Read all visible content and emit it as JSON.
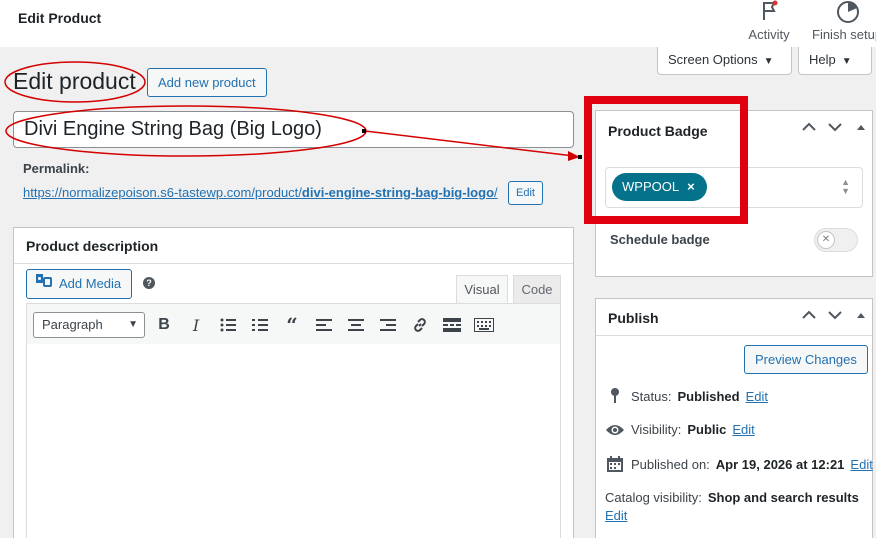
{
  "topbar": {
    "title": "Edit Product",
    "activity_label": "Activity",
    "finish_setup_label": "Finish setup"
  },
  "screen_tabs": {
    "screen_options": "Screen Options",
    "help": "Help"
  },
  "heading": {
    "title": "Edit product",
    "add_new_label": "Add new product"
  },
  "product": {
    "title": "Divi Engine String Bag (Big Logo)",
    "permalink_label": "Permalink:",
    "permalink_base": "https://normalizepoison.s6-tastewp.com/product/",
    "permalink_slug": "divi-engine-string-bag-big-logo",
    "permalink_tail": "/",
    "edit_label": "Edit"
  },
  "description": {
    "title": "Product description",
    "add_media_label": "Add Media",
    "help_glyph": "?",
    "tab_visual": "Visual",
    "tab_code": "Code",
    "format_select": "Paragraph"
  },
  "badge_box": {
    "title": "Product Badge",
    "selected_badge": "WPPOOL",
    "remove_glyph": "×",
    "schedule_label": "Schedule badge",
    "schedule_enabled": false,
    "highlight_color": "#e1000f"
  },
  "publish_box": {
    "title": "Publish",
    "preview_label": "Preview Changes",
    "status_label": "Status:",
    "status_value": "Published",
    "visibility_label": "Visibility:",
    "visibility_value": "Public",
    "published_label": "Published on:",
    "published_value": "Apr 19, 2026 at 12:21",
    "catalog_label": "Catalog visibility:",
    "catalog_value": "Shop and search results",
    "edit_label": "Edit"
  },
  "colors": {
    "accent": "#2271b1",
    "badge": "#03728a",
    "annotation": "#e1000f"
  }
}
